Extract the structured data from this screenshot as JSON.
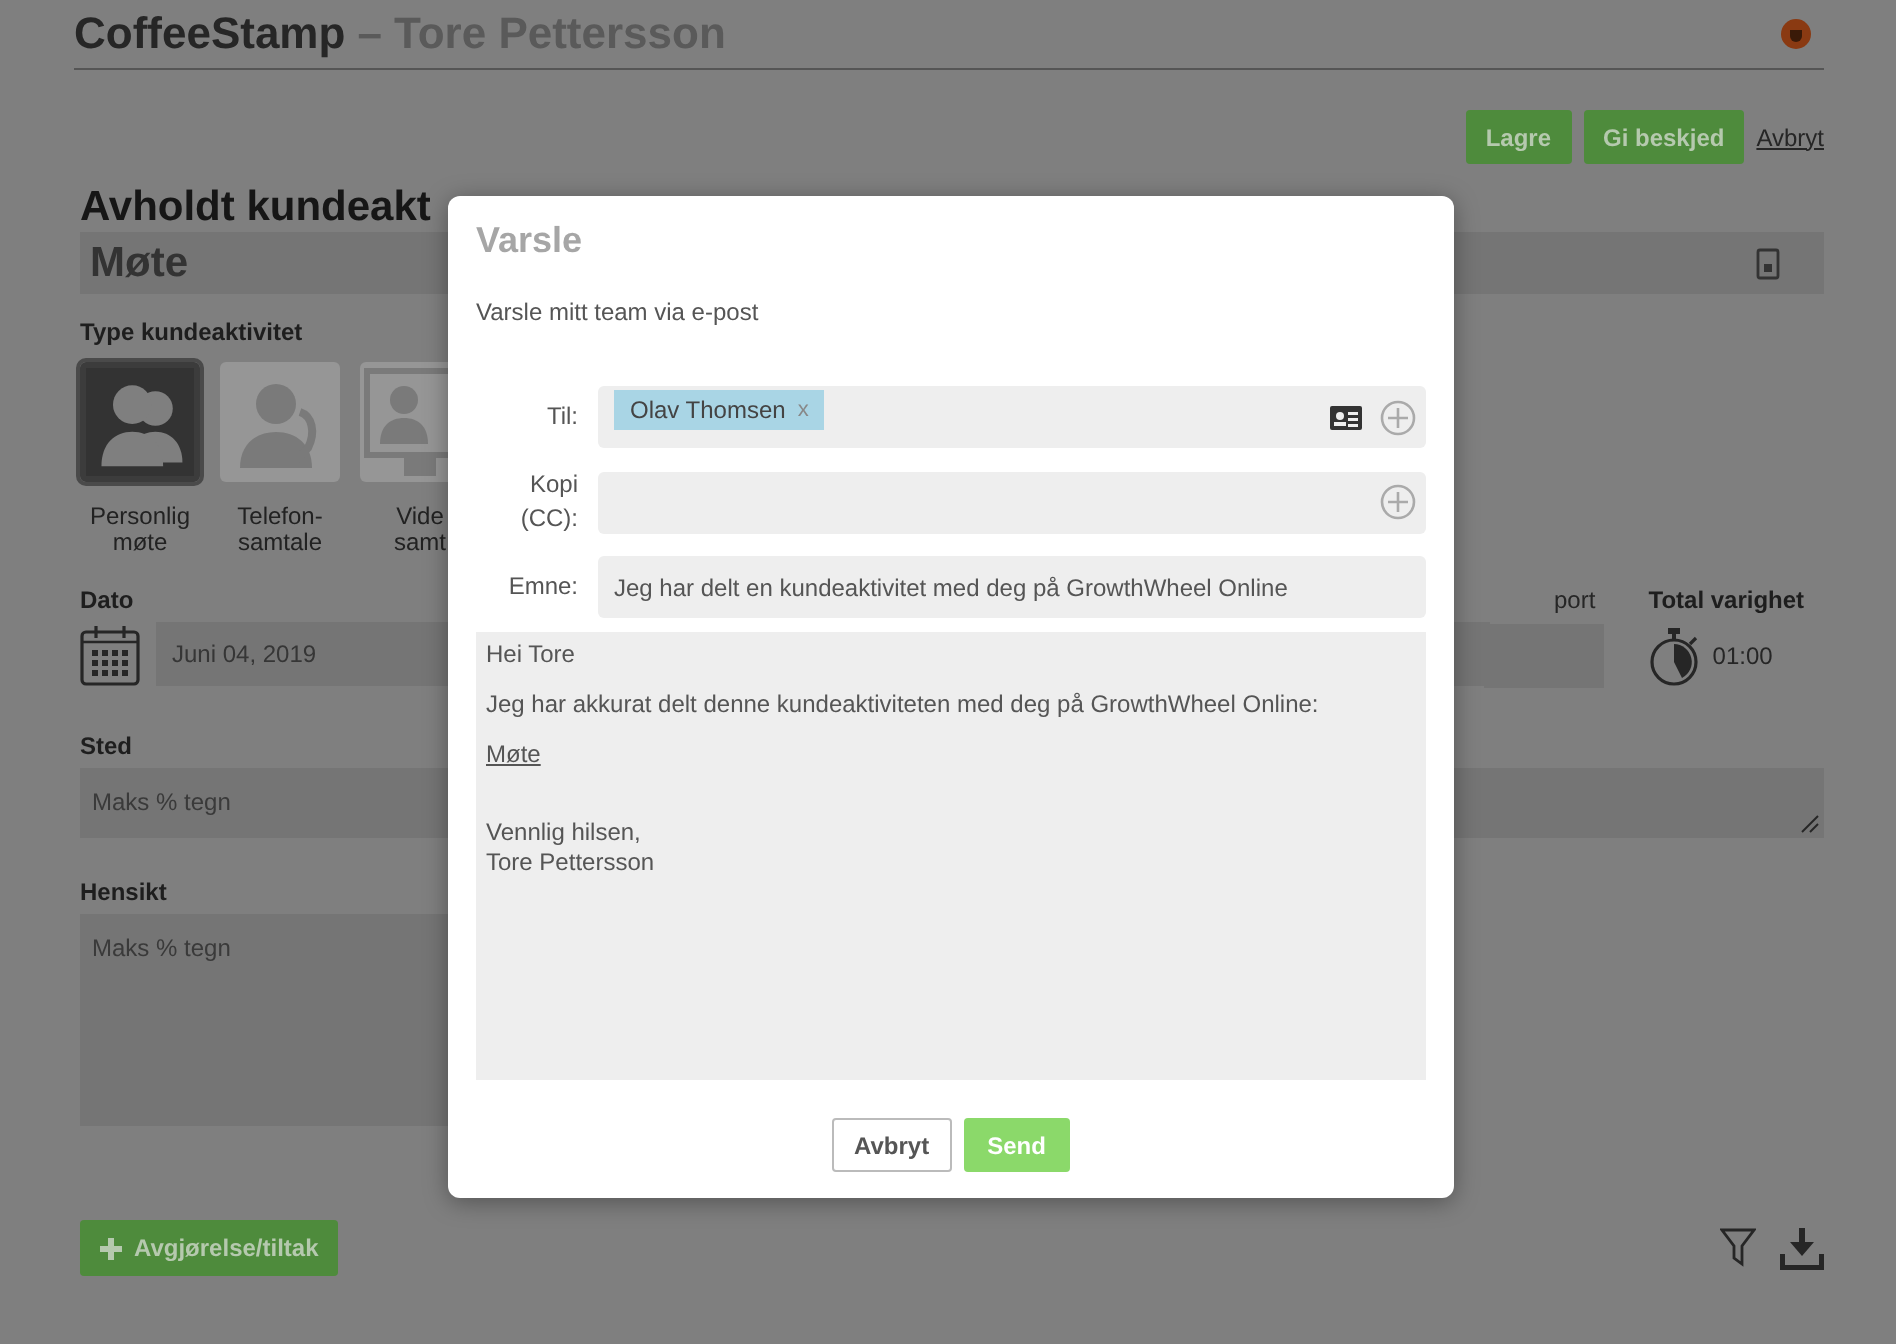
{
  "header": {
    "brand": "CoffeeStamp",
    "user": "– Tore Pettersson"
  },
  "actions": [
    {
      "label": "Lagre",
      "kind": "button"
    },
    {
      "label": "Gi beskjed",
      "kind": "button"
    },
    {
      "label": "Avbryt",
      "kind": "link"
    }
  ],
  "page": {
    "heading": "Avholdt kundeakt",
    "title_field": "Møte",
    "type_label": "Type kundeaktivitet",
    "types": [
      {
        "kind": "meeting",
        "lines": [
          "Personlig",
          "møte"
        ],
        "selected": true
      },
      {
        "kind": "phone",
        "lines": [
          "Telefon-",
          "samtale"
        ],
        "selected": false
      },
      {
        "kind": "video",
        "lines": [
          "Vide",
          "samt"
        ],
        "selected": false
      }
    ],
    "date_label": "Dato",
    "date": "Juni 04, 2019",
    "cut_label": "port",
    "total_label": "Total varighet",
    "total": "01:00",
    "place_label": "Sted",
    "place_placeholder": "Maks % tegn",
    "purpose_label": "Hensikt",
    "purpose_placeholder": "Maks % tegn",
    "add_button": "Avgjørelse/tiltak"
  },
  "dialog": {
    "title": "Varsle",
    "subtitle": "Varsle mitt team via e-post",
    "to_label": "Til:",
    "recipients": [
      {
        "name": "Olav Thomsen",
        "remove": "x"
      }
    ],
    "cc_label": "Kopi (CC):",
    "subject_label": "Emne:",
    "subject": "Jeg har delt en kundeaktivitet med deg på GrowthWheel Online",
    "body": [
      {
        "kind": "text",
        "lines": [
          "Hei Tore"
        ]
      },
      {
        "kind": "text",
        "lines": [
          "Jeg har akkurat delt denne kundeaktiviteten med deg på GrowthWheel Online:"
        ]
      },
      {
        "kind": "link",
        "lines": [
          "Møte"
        ]
      },
      {
        "kind": "signature",
        "lines": [
          "Vennlig hilsen,",
          "Tore Pettersson"
        ]
      }
    ],
    "buttons": [
      {
        "label": "Avbryt",
        "kind": "secondary"
      },
      {
        "label": "Send",
        "kind": "primary"
      }
    ]
  }
}
